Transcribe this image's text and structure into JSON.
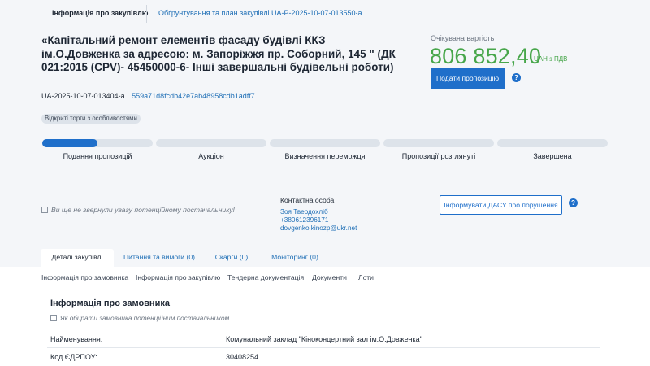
{
  "header": {
    "tab_info": "Інформація про закупівлю",
    "tab_plan": "Обґрунтування та план закупівлі UA-P-2025-10-07-013550-a"
  },
  "tender": {
    "title": "«Капітальний ремонт елементів фасаду будівлі ККЗ ім.О.Довженка за адресою: м. Запоріжжя пр. Соборний, 145 \" (ДК 021:2015 (CPV)- 45450000-6- Інші завершальні будівельні роботи)",
    "id": "UA-2025-10-07-013404-a",
    "hash": "559a71d8fcdb42e7ab48958cdb1adff7",
    "badge": "Відкриті торги з особливостями"
  },
  "price": {
    "label": "Очікувана вартість",
    "amount": "806 852,40",
    "currency": "UAH з ПДВ",
    "submit_label": "Подати пропозицію"
  },
  "stages": [
    {
      "label": "Подання пропозицій",
      "progress": 0.5
    },
    {
      "label": "Аукціон",
      "progress": 0
    },
    {
      "label": "Визначення переможця",
      "progress": 0
    },
    {
      "label": "Пропозиції розглянуті",
      "progress": 0
    },
    {
      "label": "Завершена",
      "progress": 0
    }
  ],
  "watch_label": "Ви ще не звернули увагу потенційному постачальнику!",
  "contact": {
    "title": "Контактна особа",
    "name": "Зоя Твердохліб",
    "phone": "+380612396171",
    "email": "dovgenko.kinozp@ukr.net"
  },
  "dasu_label": "Інформувати ДАСУ про порушення",
  "tabs": [
    {
      "label": "Деталі закупівлі"
    },
    {
      "label": "Питання та вимоги (0)"
    },
    {
      "label": "Скарги (0)"
    },
    {
      "label": "Моніторинг (0)"
    }
  ],
  "subtabs": [
    "Інформація про замовника",
    "Інформація про закупівлю",
    "Тендерна документація",
    "Документи",
    "Лоти"
  ],
  "customer": {
    "section_title": "Інформація про замовника",
    "watch_label": "Як обирати замовника потенційним постачальником",
    "name_label": "Найменування:",
    "name_value": "Комунальний заклад \"Кіноконцертний зал ім.О.Довженка\"",
    "edrpou_label": "Код ЄДРПОУ:",
    "edrpou_value": "30408254"
  },
  "colors": {
    "accent": "#1f6fca",
    "price_green": "#47a64a"
  }
}
